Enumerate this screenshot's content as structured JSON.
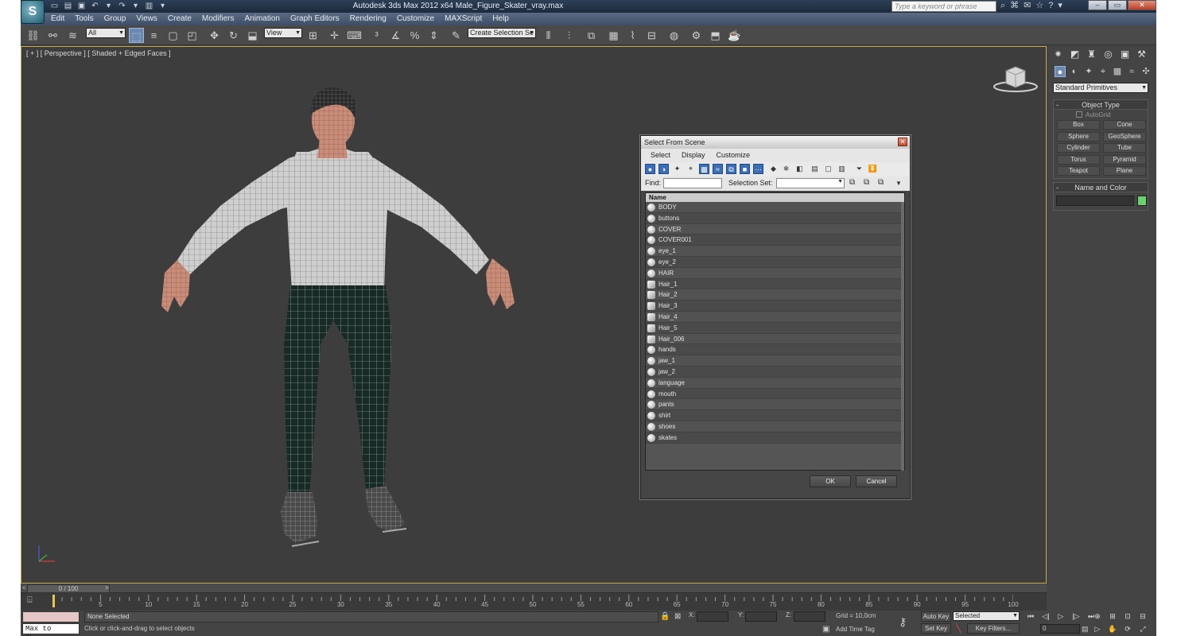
{
  "window": {
    "title": "Autodesk 3ds Max  2012 x64     Male_Figure_Skater_vray.max",
    "search_placeholder": "Type a keyword or phrase"
  },
  "menu": [
    "Edit",
    "Tools",
    "Group",
    "Views",
    "Create",
    "Modifiers",
    "Animation",
    "Graph Editors",
    "Rendering",
    "Customize",
    "MAXScript",
    "Help"
  ],
  "toolbar": {
    "filter_value": "All",
    "refcoord_value": "View",
    "selection_set_value": "Create Selection Se"
  },
  "viewport": {
    "label": "[ + ] [ Perspective ] [ Shaded + Edged Faces ]"
  },
  "command_panel": {
    "primitive_type": "Standard Primitives",
    "object_type_title": "Object Type",
    "autogrid_label": "AutoGrid",
    "primitives": [
      "Box",
      "Cone",
      "Sphere",
      "GeoSphere",
      "Cylinder",
      "Tube",
      "Torus",
      "Pyramid",
      "Teapot",
      "Plane"
    ],
    "name_color_title": "Name and Color",
    "color_hex": "#69d26b"
  },
  "timeline": {
    "slider_label": "0 / 100",
    "ticks": [
      5,
      10,
      15,
      20,
      25,
      30,
      35,
      40,
      45,
      50,
      55,
      60,
      65,
      70,
      75,
      80,
      85,
      90,
      95,
      100
    ]
  },
  "status": {
    "maxscript_text": "Max to Physc.",
    "selection": "None Selected",
    "prompt": "Click or click-and-drag to select objects",
    "x_label": "X:",
    "y_label": "Y:",
    "z_label": "Z:",
    "grid": "Grid = 10,0cm",
    "add_time_tag": "Add Time Tag",
    "auto_key": "Auto Key",
    "set_key": "Set Key",
    "selected_dd": "Selected",
    "key_filters": "Key Filters...",
    "frame_value": "0"
  },
  "dialog": {
    "title": "Select From Scene",
    "menu": [
      "Select",
      "Display",
      "Customize"
    ],
    "find_label": "Find:",
    "selection_set_label": "Selection Set:",
    "column_header": "Name",
    "objects": [
      "BODY",
      "buttons",
      "COVER",
      "COVER001",
      "eye_1",
      "eye_2",
      "HAIR",
      "Hair_1",
      "Hair_2",
      "Hair_3",
      "Hair_4",
      "Hair_5",
      "Hair_006",
      "hands",
      "jaw_1",
      "jaw_2",
      "language",
      "mouth",
      "pants",
      "shirt",
      "shoes",
      "skates"
    ],
    "hair_like": [
      "Hair_1",
      "Hair_2",
      "Hair_3",
      "Hair_4",
      "Hair_5",
      "Hair_006"
    ],
    "ok_label": "OK",
    "cancel_label": "Cancel"
  }
}
